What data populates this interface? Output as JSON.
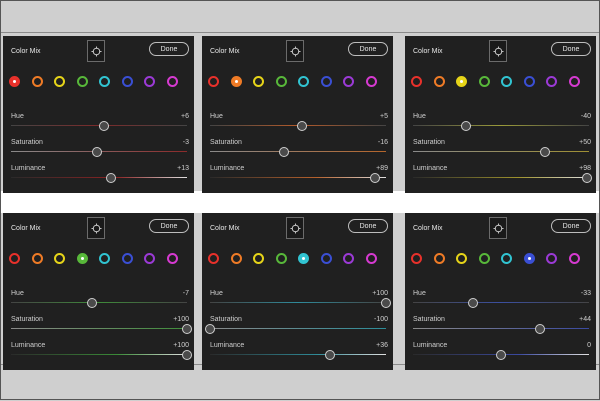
{
  "panels": [
    {
      "title": "Color Mix",
      "done_label": "Done",
      "selected": 0,
      "sliders": [
        {
          "name": "Hue",
          "value": "+6",
          "level": 0.53
        },
        {
          "name": "Saturation",
          "value": "-3",
          "level": 0.49
        },
        {
          "name": "Luminance",
          "value": "+13",
          "level": 0.57
        }
      ]
    },
    {
      "title": "Color Mix",
      "done_label": "Done",
      "selected": 1,
      "sliders": [
        {
          "name": "Hue",
          "value": "+5",
          "level": 0.52
        },
        {
          "name": "Saturation",
          "value": "-16",
          "level": 0.42
        },
        {
          "name": "Luminance",
          "value": "+89",
          "level": 0.94
        }
      ]
    },
    {
      "title": "Color Mix",
      "done_label": "Done",
      "selected": 2,
      "sliders": [
        {
          "name": "Hue",
          "value": "-40",
          "level": 0.3
        },
        {
          "name": "Saturation",
          "value": "+50",
          "level": 0.75
        },
        {
          "name": "Luminance",
          "value": "+98",
          "level": 0.99
        }
      ]
    },
    {
      "title": "Color Mix",
      "done_label": "Done",
      "selected": 3,
      "sliders": [
        {
          "name": "Hue",
          "value": "-7",
          "level": 0.46
        },
        {
          "name": "Saturation",
          "value": "+100",
          "level": 1.0
        },
        {
          "name": "Luminance",
          "value": "+100",
          "level": 1.0
        }
      ]
    },
    {
      "title": "Color Mix",
      "done_label": "Done",
      "selected": 4,
      "sliders": [
        {
          "name": "Hue",
          "value": "+100",
          "level": 1.0
        },
        {
          "name": "Saturation",
          "value": "-100",
          "level": 0.0
        },
        {
          "name": "Luminance",
          "value": "+36",
          "level": 0.68
        }
      ]
    },
    {
      "title": "Color Mix",
      "done_label": "Done",
      "selected": 5,
      "sliders": [
        {
          "name": "Hue",
          "value": "-33",
          "level": 0.34
        },
        {
          "name": "Saturation",
          "value": "+44",
          "level": 0.72
        },
        {
          "name": "Luminance",
          "value": "0",
          "level": 0.5
        }
      ]
    }
  ],
  "color_swatches": [
    {
      "icon": "red-swatch-icon",
      "color": "#e8312b"
    },
    {
      "icon": "orange-swatch-icon",
      "color": "#ef7b26"
    },
    {
      "icon": "yellow-swatch-icon",
      "color": "#e6d419"
    },
    {
      "icon": "green-swatch-icon",
      "color": "#58b83a"
    },
    {
      "icon": "aqua-swatch-icon",
      "color": "#31c4d2"
    },
    {
      "icon": "blue-swatch-icon",
      "color": "#3a4fd4"
    },
    {
      "icon": "purple-swatch-icon",
      "color": "#9b3ad6"
    },
    {
      "icon": "magenta-swatch-icon",
      "color": "#d63ad1"
    }
  ],
  "icons": {
    "target": "target-adjustment-icon"
  }
}
